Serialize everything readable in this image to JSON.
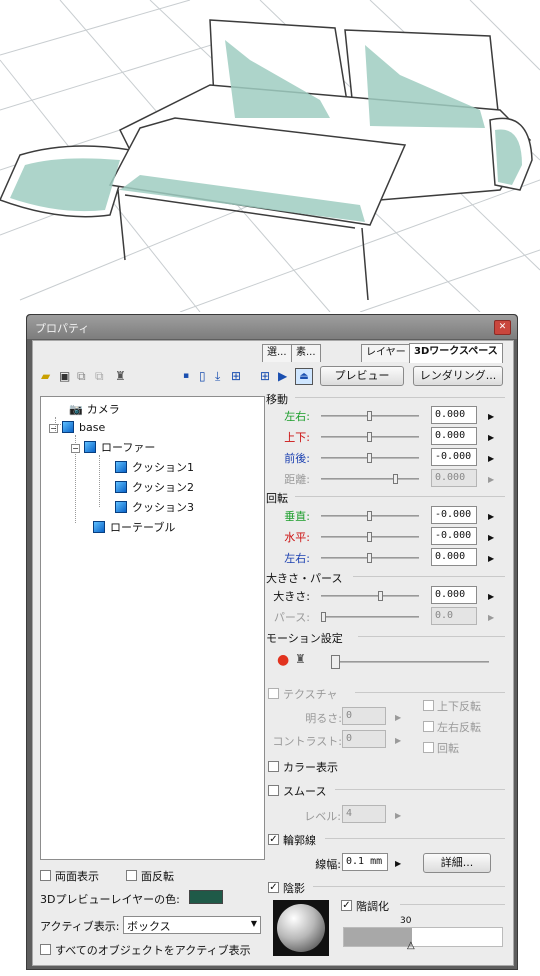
{
  "panel": {
    "title": "プロパティ",
    "tabs": [
      "選...",
      "素...",
      "レイヤー",
      "3Dワークスペース"
    ],
    "buttons": {
      "preview": "プレビュー",
      "render": "レンダリング..."
    }
  },
  "tree": {
    "items": [
      "カメラ",
      "base",
      "ローファー",
      "クッション1",
      "クッション2",
      "クッション3",
      "ローテーブル"
    ]
  },
  "move": {
    "title": "移動",
    "rows": [
      {
        "label": "左右:",
        "value": "0.000",
        "color": "#1a9d2a",
        "level": 0.5
      },
      {
        "label": "上下:",
        "value": "0.000",
        "color": "#cc1111",
        "level": 0.5
      },
      {
        "label": "前後:",
        "value": "-0.000",
        "color": "#1a3fb0",
        "level": 0.5
      },
      {
        "label": "距離:",
        "value": "0.000",
        "disabled": true,
        "level": 0.78
      }
    ]
  },
  "rotate": {
    "title": "回転",
    "rows": [
      {
        "label": "垂直:",
        "value": "-0.000",
        "color": "#1a9d2a",
        "level": 0.5
      },
      {
        "label": "水平:",
        "value": "-0.000",
        "color": "#cc1111",
        "level": 0.5
      },
      {
        "label": "左右:",
        "value": "0.000",
        "color": "#1a3fb0",
        "level": 0.5
      }
    ]
  },
  "size": {
    "title": "大きさ・パース",
    "rows": [
      {
        "label": "大きさ:",
        "value": "0.000",
        "level": 0.62
      },
      {
        "label": "パース:",
        "value": "0.0",
        "disabled": true,
        "level": 0.0
      }
    ]
  },
  "motion": {
    "title": "モーション設定"
  },
  "texture": {
    "label": "テクスチャ",
    "brightness_label": "明るさ:",
    "brightness_value": "0",
    "contrast_label": "コントラスト:",
    "contrast_value": "0",
    "flip_v": "上下反転",
    "flip_h": "左右反転",
    "rotate": "回転"
  },
  "color_display": "カラー表示",
  "smooth": {
    "label": "スムース",
    "level_label": "レベル:",
    "level_value": "4"
  },
  "outline": {
    "label": "輪郭線",
    "width_label": "線幅:",
    "width_value": "0.1 mm",
    "detail": "詳細..."
  },
  "shading": {
    "label": "陰影",
    "gradation": "階調化",
    "value": "30"
  },
  "left_options": {
    "double_sided": "両面表示",
    "invert": "面反転",
    "preview_color_label": "3Dプレビューレイヤーの色:",
    "preview_color": "#1f5a48",
    "active_label": "アクティブ表示:",
    "active_value": "ボックス",
    "all_active": "すべてのオブジェクトをアクティブ表示"
  }
}
